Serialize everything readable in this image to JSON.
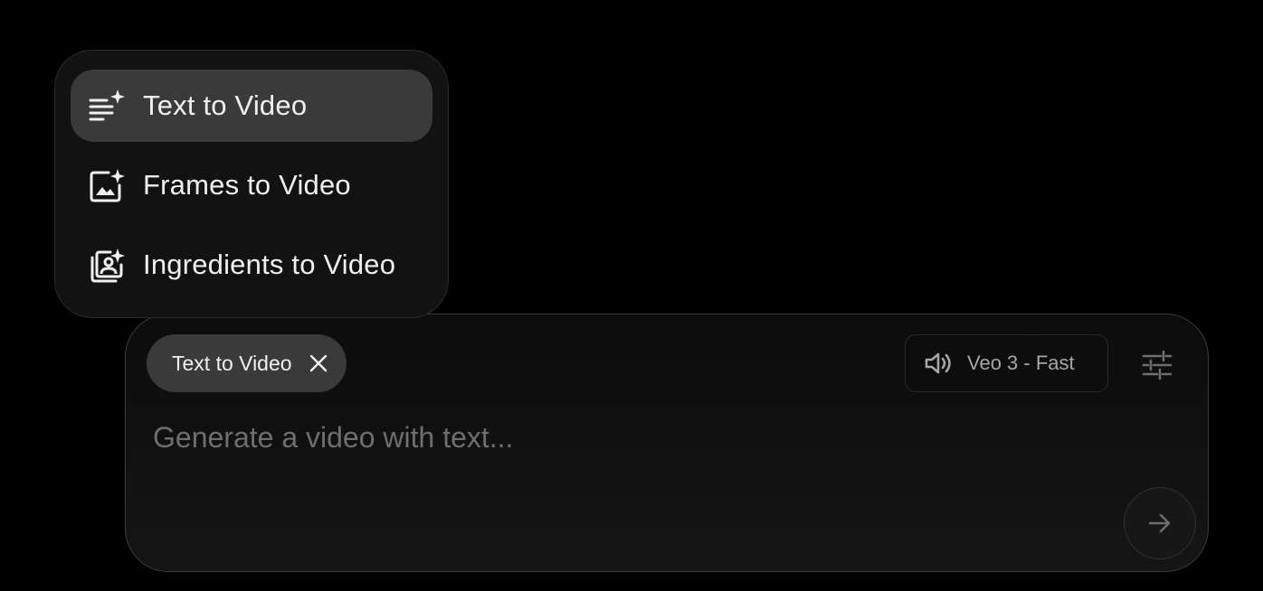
{
  "mode_menu": {
    "items": [
      {
        "label": "Text to Video",
        "icon": "text-sparkle-icon",
        "selected": true
      },
      {
        "label": "Frames to Video",
        "icon": "image-sparkle-icon",
        "selected": false
      },
      {
        "label": "Ingredients to Video",
        "icon": "portrait-stack-sparkle-icon",
        "selected": false
      }
    ]
  },
  "composer": {
    "mode_chip": {
      "label": "Text to Video",
      "close_icon": "close-icon"
    },
    "model_selector": {
      "label": "Veo 3 - Fast",
      "icon": "volume-icon"
    },
    "settings_icon": "tune-sliders-icon",
    "prompt": {
      "placeholder": "Generate a video with text...",
      "value": ""
    },
    "send_icon": "arrow-right-icon"
  },
  "colors": {
    "background": "#000000",
    "menu_bg": "#121212",
    "menu_selected": "#3a3a3a",
    "text_primary": "#f0f0f0",
    "text_muted": "#a6a6a6",
    "placeholder": "#6e6e6e"
  }
}
